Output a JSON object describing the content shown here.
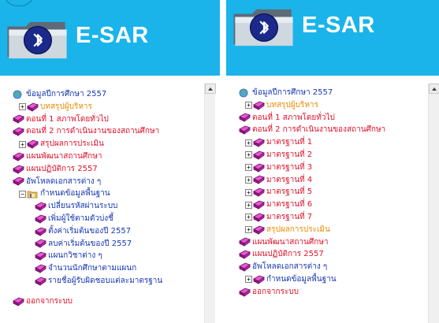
{
  "colors": {
    "banner_bg": "#1ab4ea",
    "link_blue": "#1637b3",
    "link_red": "#e0102a",
    "link_orange": "#f08a00",
    "book_icon": "#b0169e"
  },
  "icons": {
    "root": "globe-icon",
    "item": "book-icon",
    "folder": "folder-icon",
    "expand": "plus-box-icon",
    "collapse": "minus-box-icon"
  },
  "left_panel": {
    "banner_title": "E-SAR",
    "tree": {
      "root": "ข้อมูลปีการศึกษา 2557",
      "executive": "บทสรุปผู้บริหาร",
      "part1": "ตอนที่ 1 สภาพโดยทั่วไป",
      "part2": "ตอนที่ 2 การดำเนินงานของสถานศึกษา",
      "eval": "สรุปผลการประเมิน",
      "dev_plan": "แผนพัฒนาสถานศึกษา",
      "action_plan": "แผนปฏิบัติการ 2557",
      "upload": "อัพโหลดเอกสารต่าง ๆ",
      "basic": "กำหนดข้อมูลพื้นฐาน",
      "sub": [
        "เปลี่ยนรหัสผ่านระบบ",
        "เพิ่มผู้ใช้ตามตัวบ่งชี้",
        "ตั้งค่าเริ่มต้นของปี 2557",
        "ลบค่าเริ่มต้นของปี 2557",
        "แผนกวิชาต่าง ๆ",
        "จำนวนนักศึกษาตามแผนก",
        "รายชื่อผู้รับผิดชอบแต่ละมาตรฐาน"
      ],
      "logout": "ออกจากระบบ"
    }
  },
  "right_panel": {
    "banner_title": "E-SAR",
    "tree": {
      "root": "ข้อมูลปีการศึกษา 2557",
      "executive": "บทสรุปผู้บริหาร",
      "part1": "ตอนที่ 1 สภาพโดยทั่วไป",
      "part2": "ตอนที่ 2 การดำเนินงานของสถานศึกษา",
      "standards": [
        "มาตรฐานที่ 1",
        "มาตรฐานที่ 2",
        "มาตรฐานที่ 3",
        "มาตรฐานที่ 4",
        "มาตรฐานที่ 5",
        "มาตรฐานที่ 6",
        "มาตรฐานที่ 7"
      ],
      "eval": "สรุปผลการประเมิน",
      "dev_plan": "แผนพัฒนาสถานศึกษา",
      "action_plan": "แผนปฏิบัติการ 2557",
      "upload": "อัพโหลดเอกสารต่าง ๆ",
      "basic": "กำหนดข้อมูลพื้นฐาน",
      "logout": "ออกจากระบบ"
    }
  }
}
